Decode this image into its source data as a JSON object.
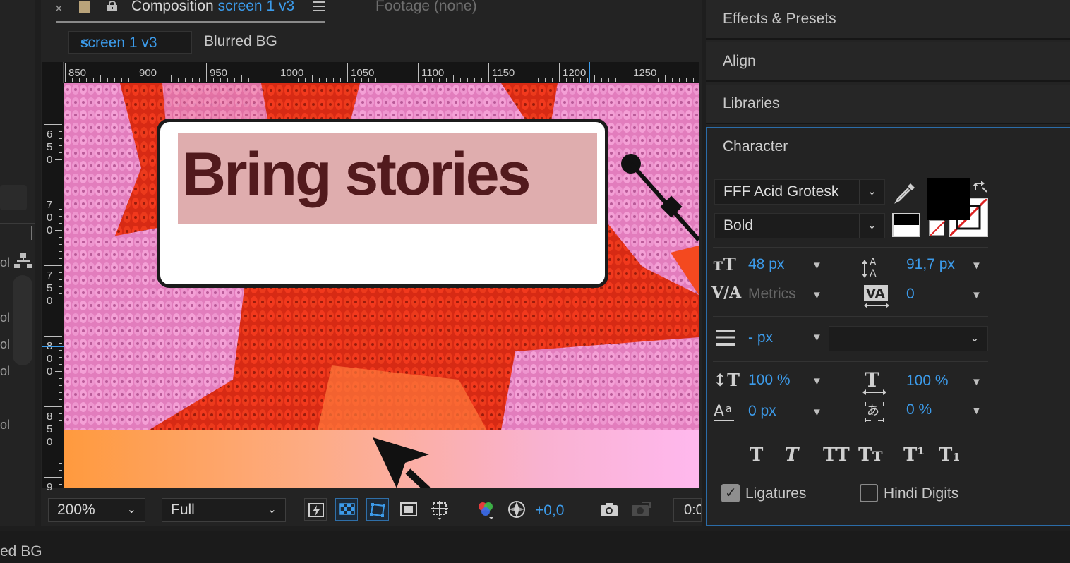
{
  "left_strip": {
    "labels": [
      "ol",
      "ol",
      "ol",
      "ol",
      "ol"
    ]
  },
  "comp_tab": {
    "close": "×",
    "title_prefix": "Composition",
    "title_name": "screen 1 v3",
    "footage_tab": "Footage (none)"
  },
  "breadcrumb": {
    "active": "screen 1 v3",
    "chevron": "<",
    "next": "Blurred BG"
  },
  "ruler": {
    "top_labels": [
      "850",
      "900",
      "950",
      "1000",
      "1050",
      "1100",
      "1150",
      "1200",
      "1250"
    ],
    "left_labels": [
      "650",
      "700",
      "750",
      "800",
      "850",
      "9"
    ]
  },
  "canvas": {
    "headline": "Bring stories"
  },
  "view_bar": {
    "zoom": "200%",
    "resolution": "Full",
    "exposure": "+0,0",
    "timecode": "0:0"
  },
  "right_panels": {
    "effects": "Effects & Presets",
    "align": "Align",
    "libraries": "Libraries",
    "character": "Character"
  },
  "character": {
    "font_family": "FFF Acid Grotesk",
    "font_style": "Bold",
    "font_size": "48 px",
    "leading": "91,7 px",
    "kerning": "Metrics",
    "tracking": "0",
    "stroke_width": "- px",
    "stroke_mode": "",
    "vertical_scale": "100 %",
    "horizontal_scale": "100 %",
    "baseline_shift": "0 px",
    "tsume": "0 %",
    "ligatures_label": "Ligatures",
    "ligatures_checked": true,
    "hindi_digits_label": "Hindi Digits",
    "hindi_digits_checked": false,
    "fill_color": "#000000",
    "stroke_color": "#ffffff",
    "style_buttons": [
      "T",
      "T",
      "TT",
      "Tт",
      "T¹",
      "T₁"
    ]
  },
  "status_bar": {
    "text": "ed BG"
  }
}
